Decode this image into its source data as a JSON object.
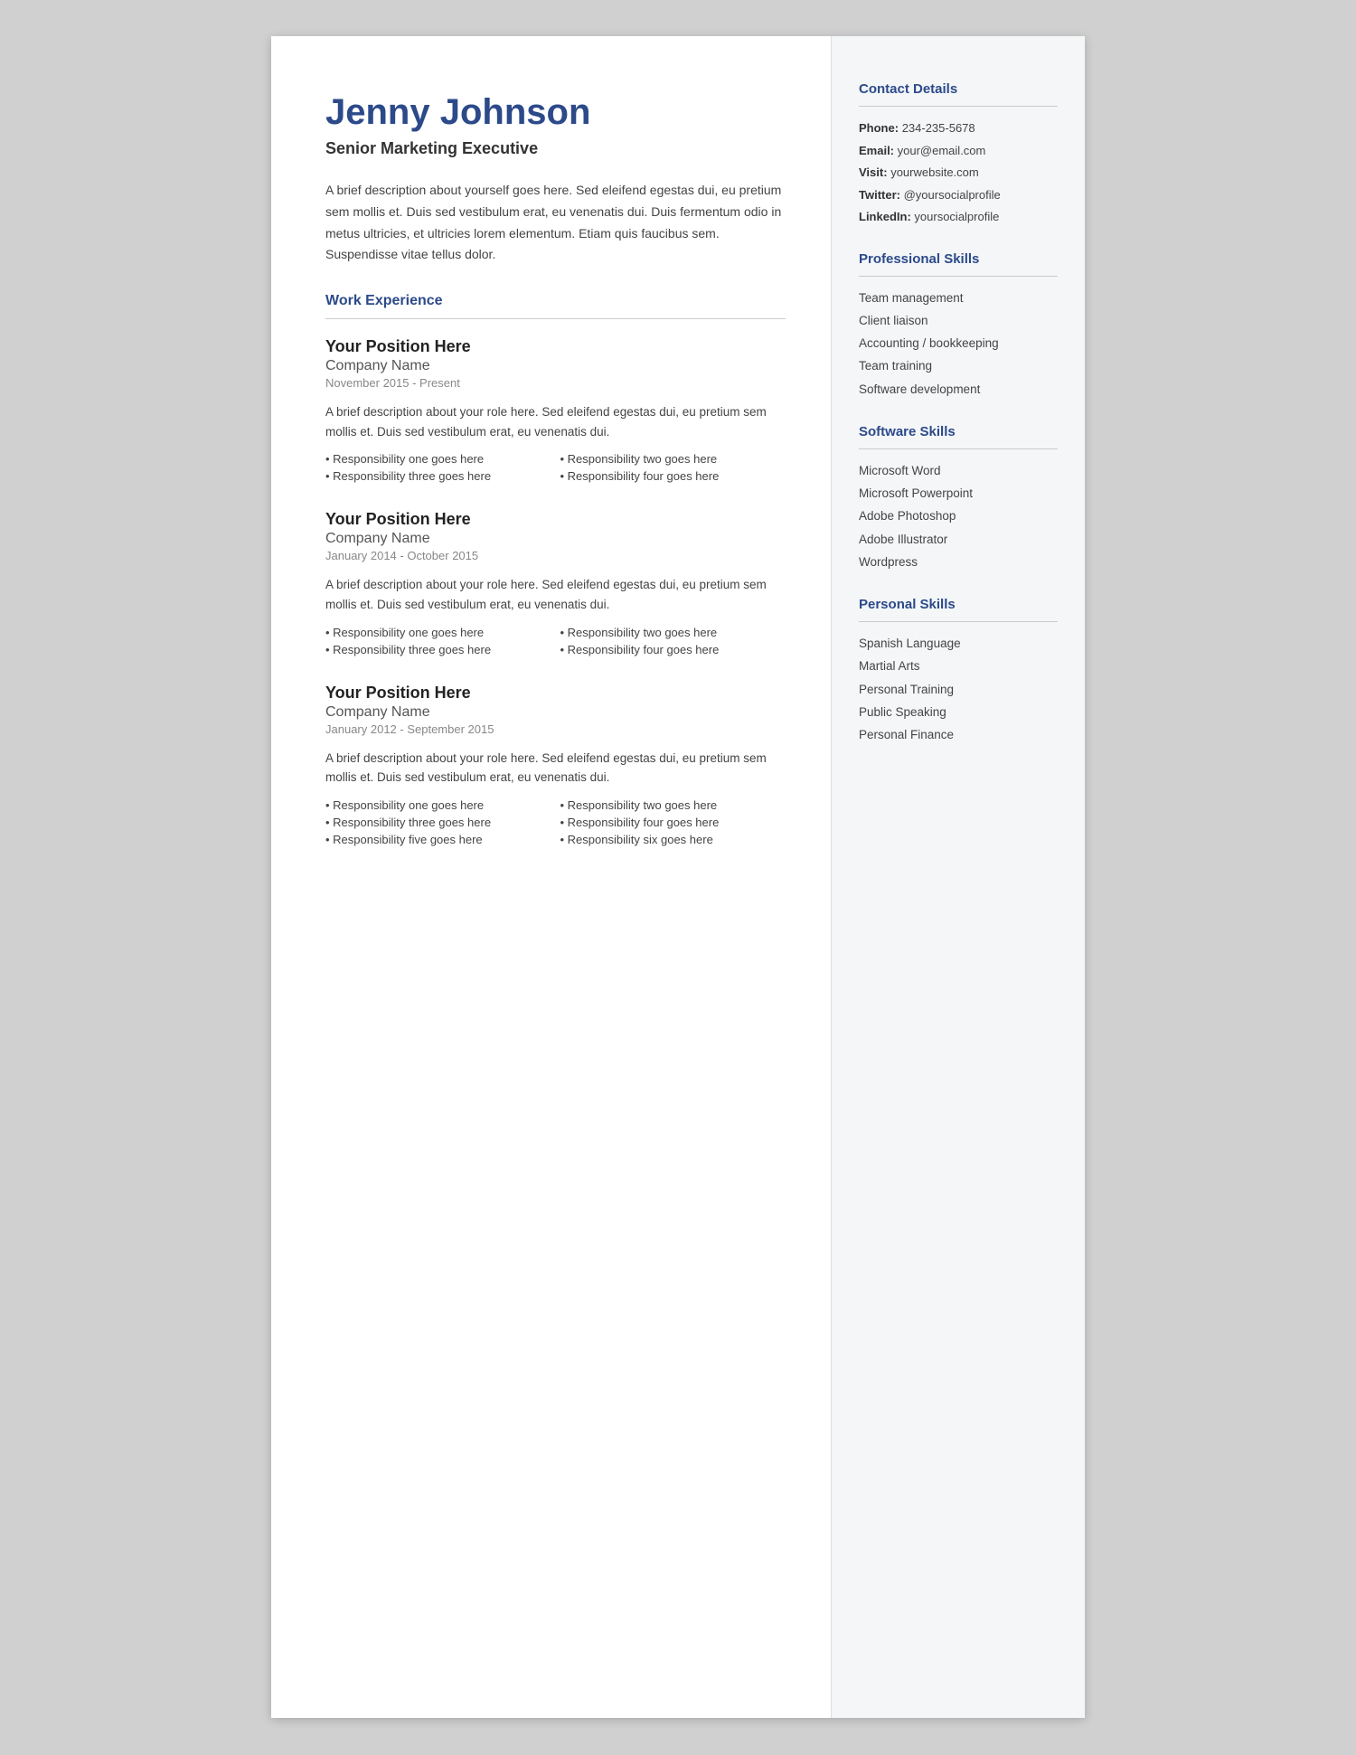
{
  "header": {
    "name": "Jenny Johnson",
    "title": "Senior Marketing Executive",
    "bio": "A brief description about yourself goes here. Sed eleifend egestas dui, eu pretium sem mollis et. Duis sed vestibulum erat, eu venenatis dui. Duis fermentum odio in metus ultricies, et ultricies lorem elementum. Etiam quis faucibus sem. Suspendisse vitae tellus dolor."
  },
  "work_experience": {
    "heading": "Work Experience",
    "jobs": [
      {
        "position": "Your Position Here",
        "company": "Company Name",
        "dates": "November 2015 - Present",
        "description": "A brief description about your role here. Sed eleifend egestas dui, eu pretium sem mollis et. Duis sed vestibulum erat, eu venenatis dui.",
        "responsibilities": [
          "Responsibility one goes here",
          "Responsibility two goes here",
          "Responsibility three goes here",
          "Responsibility four goes here"
        ]
      },
      {
        "position": "Your Position Here",
        "company": "Company Name",
        "dates": "January 2014 - October 2015",
        "description": "A brief description about your role here. Sed eleifend egestas dui, eu pretium sem mollis et. Duis sed vestibulum erat, eu venenatis dui.",
        "responsibilities": [
          "Responsibility one goes here",
          "Responsibility two goes here",
          "Responsibility three goes here",
          "Responsibility four goes here"
        ]
      },
      {
        "position": "Your Position Here",
        "company": "Company Name",
        "dates": "January 2012 - September 2015",
        "description": "A brief description about your role here. Sed eleifend egestas dui, eu pretium sem mollis et. Duis sed vestibulum erat, eu venenatis dui.",
        "responsibilities": [
          "Responsibility one goes here",
          "Responsibility two goes here",
          "Responsibility three goes here",
          "Responsibility four goes here",
          "Responsibility five goes here",
          "Responsibility six goes here"
        ]
      }
    ]
  },
  "sidebar": {
    "contact": {
      "heading": "Contact Details",
      "phone_label": "Phone:",
      "phone": "234-235-5678",
      "email_label": "Email:",
      "email": "your@email.com",
      "visit_label": "Visit:",
      "visit": "yourwebsite.com",
      "twitter_label": "Twitter:",
      "twitter": "@yoursocialprofile",
      "linkedin_label": "LinkedIn:",
      "linkedin": "yoursocialprofile"
    },
    "professional_skills": {
      "heading": "Professional Skills",
      "items": [
        "Team management",
        "Client liaison",
        "Accounting / bookkeeping",
        "Team training",
        "Software development"
      ]
    },
    "software_skills": {
      "heading": "Software Skills",
      "items": [
        "Microsoft Word",
        "Microsoft Powerpoint",
        "Adobe Photoshop",
        "Adobe Illustrator",
        "Wordpress"
      ]
    },
    "personal_skills": {
      "heading": "Personal Skills",
      "items": [
        "Spanish Language",
        "Martial Arts",
        "Personal Training",
        "Public Speaking",
        "Personal Finance"
      ]
    }
  }
}
